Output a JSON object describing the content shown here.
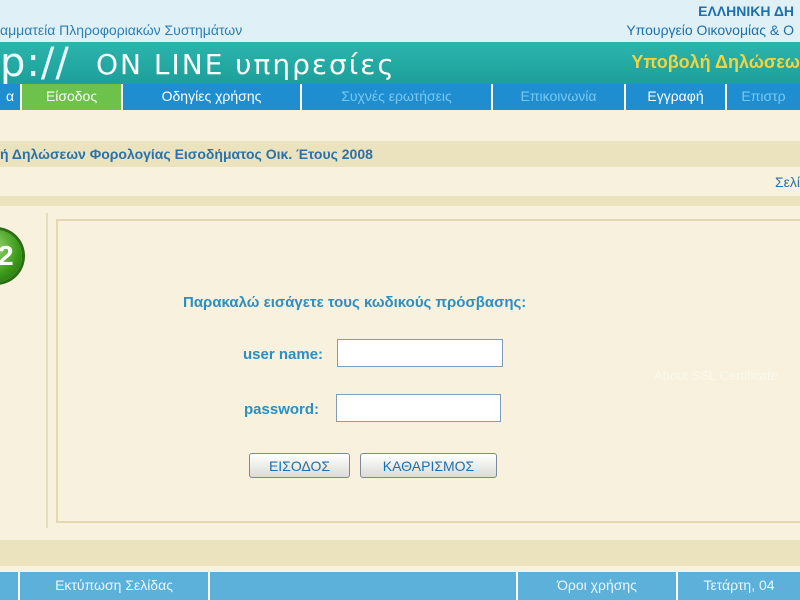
{
  "header": {
    "org_left": "αμματεία Πληροφοριακών Συστημάτων",
    "org_right_1": "ΕΛΛΗΝΙΚΗ ΔΗ",
    "org_right_2": "Υπουργείο Οικονομίας & Ο"
  },
  "banner": {
    "logo": "p://",
    "logo_sub": "ON LINE υπηρεσίες",
    "title": "Υποβολή Δηλώσεω"
  },
  "nav": {
    "items": [
      {
        "label": "α"
      },
      {
        "label": "Είσοδος"
      },
      {
        "label": "Οδηγίες χρήσης"
      },
      {
        "label": "Συχνές ερωτήσεις"
      },
      {
        "label": "Επικοινωνία"
      },
      {
        "label": "Εγγραφή"
      },
      {
        "label": "Επιστρ"
      }
    ]
  },
  "subtitle": "ή Δηλώσεων Φορολογίας Εισοδήματος Οικ. Έτους 2008",
  "page_link": "Σελί",
  "badge_number": "2",
  "login": {
    "prompt": "Παρακαλώ εισάγετε τους κωδικούς πρόσβασης:",
    "username_label": "user name:",
    "username_value": "",
    "password_label": "password:",
    "password_value": "",
    "submit_label": "ΕΙΣΟΔΟΣ",
    "reset_label": "ΚΑΘΑΡΙΣΜΟΣ"
  },
  "ssl_text": "About SSL Certificate",
  "footer": {
    "items": [
      {
        "label": ""
      },
      {
        "label": "Εκτύπωση Σελίδας"
      },
      {
        "label": ""
      },
      {
        "label": "Όροι χρήσης"
      },
      {
        "label": "Τετάρτη, 04"
      }
    ]
  },
  "colors": {
    "nav_bg": "#1f8ed0",
    "nav_active": "#6cc24a",
    "banner_bg": "#1d9f9a",
    "banner_title": "#f5d33c",
    "text_accent": "#2a8fc4"
  }
}
